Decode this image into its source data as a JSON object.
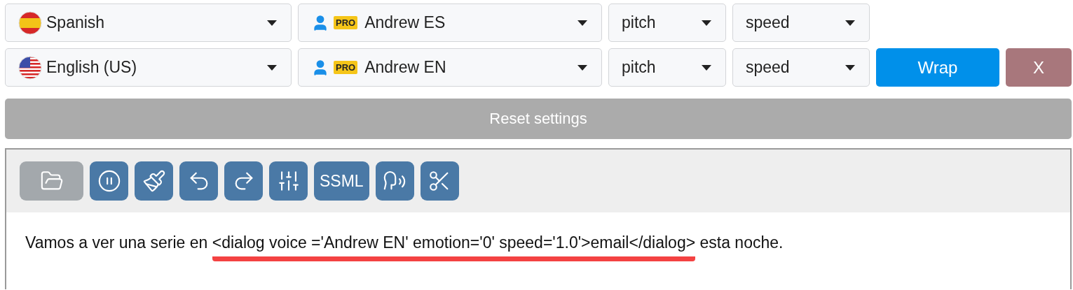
{
  "rows": [
    {
      "language": {
        "kind": "es",
        "label": "Spanish"
      },
      "voice": {
        "badge": "PRO",
        "label": "Andrew ES"
      },
      "pitch": "pitch",
      "speed": "speed"
    },
    {
      "language": {
        "kind": "us",
        "label": "English (US)"
      },
      "voice": {
        "badge": "PRO",
        "label": "Andrew EN"
      },
      "pitch": "pitch",
      "speed": "speed",
      "buttons": [
        {
          "kind": "wrap",
          "label": "Wrap"
        },
        {
          "kind": "remove",
          "label": "X"
        }
      ]
    }
  ],
  "reset_button": {
    "label": "Reset settings",
    "disabled": true
  },
  "toolbar": [
    {
      "kind": "open",
      "disabled": true
    },
    {
      "kind": "pause",
      "disabled": false
    },
    {
      "kind": "clear",
      "disabled": false
    },
    {
      "kind": "undo",
      "disabled": false
    },
    {
      "kind": "redo",
      "disabled": false
    },
    {
      "kind": "settings",
      "disabled": false
    },
    {
      "kind": "text",
      "label": "SSML",
      "disabled": false
    },
    {
      "kind": "voice",
      "disabled": false
    },
    {
      "kind": "cut",
      "disabled": false
    }
  ],
  "editor": {
    "parts": [
      {
        "text": "Vamos a ver una serie en ",
        "underlined": false
      },
      {
        "text": "<dialog voice ='Andrew EN' emotion='0' speed='1.0'>email</dialog>",
        "underlined": true
      },
      {
        "text": " esta noche.",
        "underlined": false
      }
    ]
  }
}
